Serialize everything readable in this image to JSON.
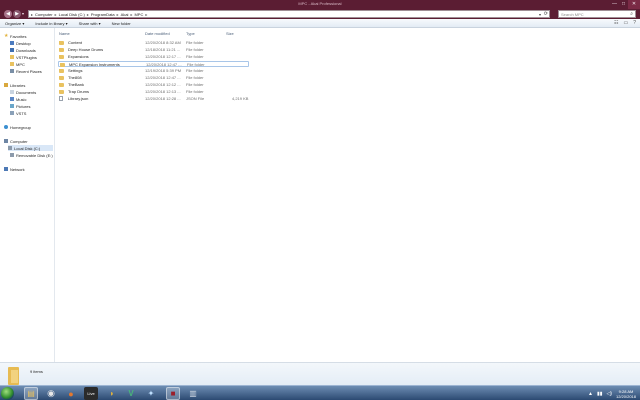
{
  "window": {
    "title": "MPC - Akai Professional",
    "minimize_glyph": "—",
    "maximize_glyph": "□",
    "close_glyph": "✕"
  },
  "nav": {
    "back_glyph": "◀",
    "forward_glyph": "▶",
    "recent_glyph": "▾"
  },
  "address": {
    "separator": "▸",
    "crumbs": [
      "Computer",
      "Local Disk (C:)",
      "ProgramData",
      "Akai",
      "MPC"
    ],
    "dropdown_glyph": "▾",
    "refresh_glyph": "⟳"
  },
  "search": {
    "placeholder": "Search MPC",
    "icon": "search-icon",
    "glyph": "⌕"
  },
  "toolbar": {
    "organize": "Organize ▾",
    "include": "Include in library ▾",
    "share": "Share with ▾",
    "new_folder": "New folder",
    "views_glyph": "☷",
    "preview_glyph": "▭",
    "help_glyph": "?"
  },
  "sidebar": {
    "favorites": "Favorites",
    "favorite_items": [
      "Desktop",
      "Downloads",
      "VSTPlugins",
      "MPC",
      "Recent Places"
    ],
    "libraries": "Libraries",
    "library_items": [
      "Documents",
      "Music",
      "Pictures",
      "VSTS"
    ],
    "homegroup": "Homegroup",
    "computer": "Computer",
    "computer_items": [
      "Local Disk (C:)",
      "Removable Disk (E:)"
    ],
    "network": "Network"
  },
  "columns": {
    "name": "Name",
    "date": "Date modified",
    "type": "Type",
    "size": "Size"
  },
  "files": [
    {
      "name": "Content",
      "date": "12/20/2018 8:32 AM",
      "type": "File folder",
      "size": "",
      "kind": "folder"
    },
    {
      "name": "Deep House Drums",
      "date": "12/18/2018 11:21 ...",
      "type": "File folder",
      "size": "",
      "kind": "folder"
    },
    {
      "name": "Expansions",
      "date": "12/20/2018 12:17 ...",
      "type": "File folder",
      "size": "",
      "kind": "folder"
    },
    {
      "name": "MPC Expansion Instruments",
      "date": "12/20/2018 12:47 ...",
      "type": "File folder",
      "size": "",
      "kind": "folder",
      "selected": true
    },
    {
      "name": "Settings",
      "date": "12/19/2018 5:39 PM",
      "type": "File folder",
      "size": "",
      "kind": "folder"
    },
    {
      "name": "The808",
      "date": "12/20/2018 12:47 ...",
      "type": "File folder",
      "size": "",
      "kind": "folder"
    },
    {
      "name": "TheBank",
      "date": "12/20/2018 12:12 ...",
      "type": "File folder",
      "size": "",
      "kind": "folder"
    },
    {
      "name": "Trap Drums",
      "date": "12/20/2018 12:13 ...",
      "type": "File folder",
      "size": "",
      "kind": "folder"
    },
    {
      "name": "Library.json",
      "date": "12/20/2018 12:28 ...",
      "type": "JSON File",
      "size": "4,219 KB",
      "kind": "file"
    }
  ],
  "status": {
    "item_count": "9 items"
  },
  "taskbar": {
    "apps": [
      "windows-explorer",
      "chrome",
      "firefox",
      "daw",
      "media-player",
      "vs-code",
      "bluetooth",
      "mpc",
      "recycle"
    ],
    "labels": [
      "",
      "",
      "",
      "Live",
      "",
      "",
      "",
      "",
      ""
    ],
    "app_glyphs": [
      "▤",
      "◉",
      "●",
      "",
      "◑",
      "V",
      "✦",
      "■",
      "▥"
    ],
    "app_colors": [
      "#e9c260",
      "#4a8bd8",
      "#e3782f",
      "#2b2b2b",
      "#e2b23b",
      "#2a8a5a",
      "#3a87c8",
      "#9b1e2a",
      "#cfd7e2"
    ],
    "tray_glyphs": [
      "▲",
      "▮▮",
      "◁)"
    ],
    "time": "9:28 AM",
    "date": "12/20/2018"
  },
  "colors": {
    "title_bar": "#5b1d33",
    "folder": "#e9c260",
    "selection": "#d9e7f7"
  }
}
